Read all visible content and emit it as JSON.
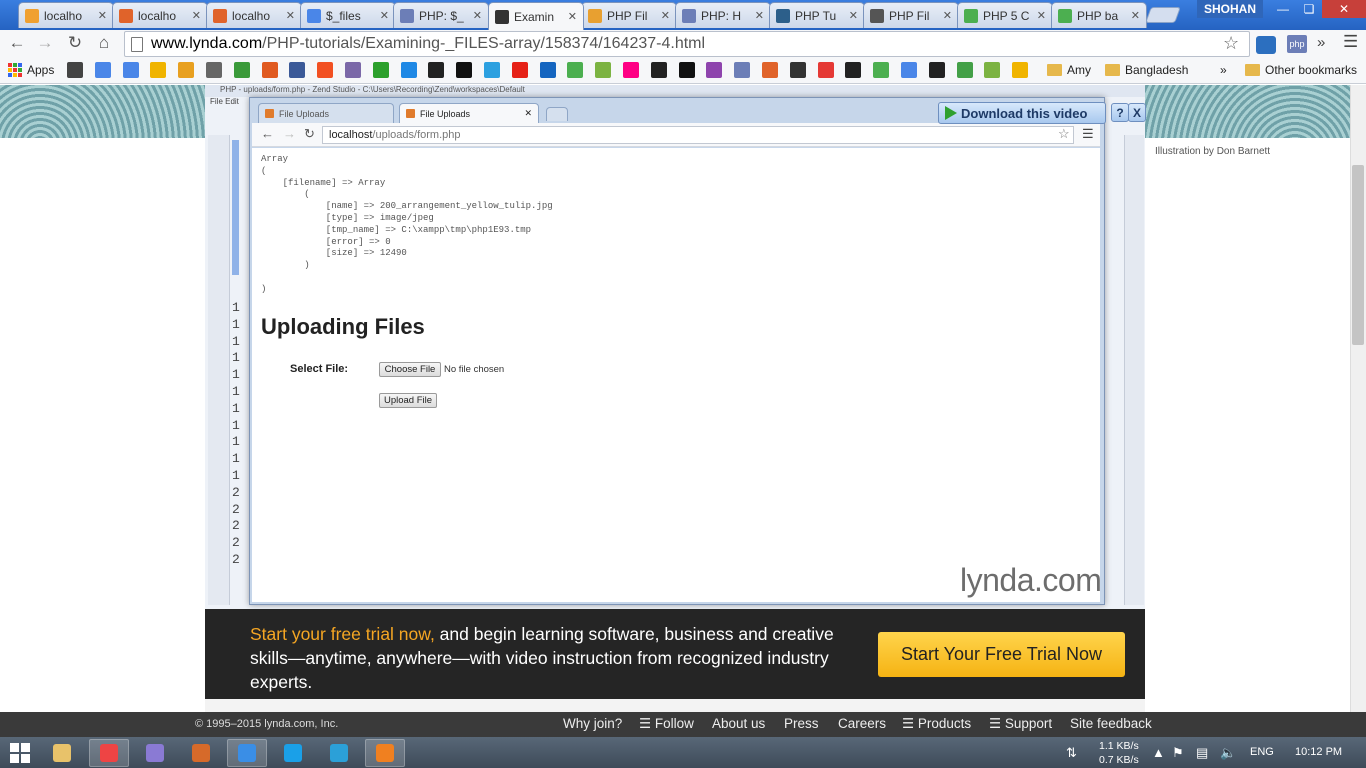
{
  "browser": {
    "tabs": [
      {
        "label": "localho",
        "icon": "pma-icon",
        "color": "#f0a030"
      },
      {
        "label": "localho",
        "icon": "xampp-icon",
        "color": "#e0632a"
      },
      {
        "label": "localho",
        "icon": "xampp-icon",
        "color": "#e0632a"
      },
      {
        "label": "$_files",
        "icon": "google-icon",
        "color": "#4a86e8"
      },
      {
        "label": "PHP: $_",
        "icon": "php-icon",
        "color": "#6c7eb7"
      },
      {
        "label": "Examin",
        "icon": "lynda-icon",
        "color": "#333333"
      },
      {
        "label": "PHP Fil",
        "icon": "pencil-icon",
        "color": "#e8a030"
      },
      {
        "label": "PHP: H",
        "icon": "php-icon",
        "color": "#6c7eb7"
      },
      {
        "label": "PHP Tu",
        "icon": "tutsplus-icon",
        "color": "#2c5f8a"
      },
      {
        "label": "PHP Fil",
        "icon": "diamond-icon",
        "color": "#555555"
      },
      {
        "label": "PHP 5 C",
        "icon": "w3schools-icon",
        "color": "#4caf50"
      },
      {
        "label": "PHP ba",
        "icon": "w3schools-icon",
        "color": "#4caf50"
      }
    ],
    "user": "SHOHAN",
    "url_domain": "www.lynda.com",
    "url_path": "/PHP-tutorials/Examining-_FILES-array/158374/164237-4.html",
    "bookmarks": {
      "apps": "Apps",
      "folder1": "Amy",
      "folder2": "Bangladesh",
      "overflow": "»",
      "other": "Other bookmarks"
    }
  },
  "page": {
    "credit": "Illustration by Don Barnett",
    "download_video": "Download this video",
    "help_btn": "?",
    "close_btn": "X",
    "watermark": "lynda.com"
  },
  "zend": {
    "title": "PHP - uploads/form.php - Zend Studio - C:\\Users\\Recording\\Zend\\workspaces\\Default",
    "menu": "File  Edit",
    "line_numbers": [
      "1",
      "1",
      "1",
      "1",
      "1",
      "1",
      "1",
      "1",
      "1",
      "1",
      "1",
      "2",
      "2",
      "2",
      "2",
      "2"
    ]
  },
  "inner_browser": {
    "tab1": "File Uploads",
    "tab2": "File Uploads",
    "url_host": "localhost",
    "url_path": "/uploads/form.php",
    "pre_output": "Array\n(\n    [filename] => Array\n        (\n            [name] => 200_arrangement_yellow_tulip.jpg\n            [type] => image/jpeg\n            [tmp_name] => C:\\xampp\\tmp\\php1E93.tmp\n            [error] => 0\n            [size] => 12490\n        )\n\n)",
    "heading": "Uploading Files",
    "select_label": "Select File:",
    "choose_btn": "Choose File",
    "no_file": "No file chosen",
    "upload_btn": "Upload File"
  },
  "promo": {
    "highlight": "Start your free trial now,",
    "text": " and begin learning software, business and creative skills—anytime, anywhere—with video instruction from recognized industry experts.",
    "button": "Start Your Free Trial Now"
  },
  "footer": {
    "copyright": "© 1995–2015 lynda.com, Inc.",
    "links": [
      "Why join?",
      "☰ Follow",
      "About us",
      "Press",
      "Careers",
      "☰ Products",
      "☰ Support",
      "Site feedback"
    ]
  },
  "taskbar": {
    "net_down": "1.1 KB/s",
    "net_up": "0.7 KB/s",
    "lang": "ENG",
    "time": "10:12 PM"
  }
}
